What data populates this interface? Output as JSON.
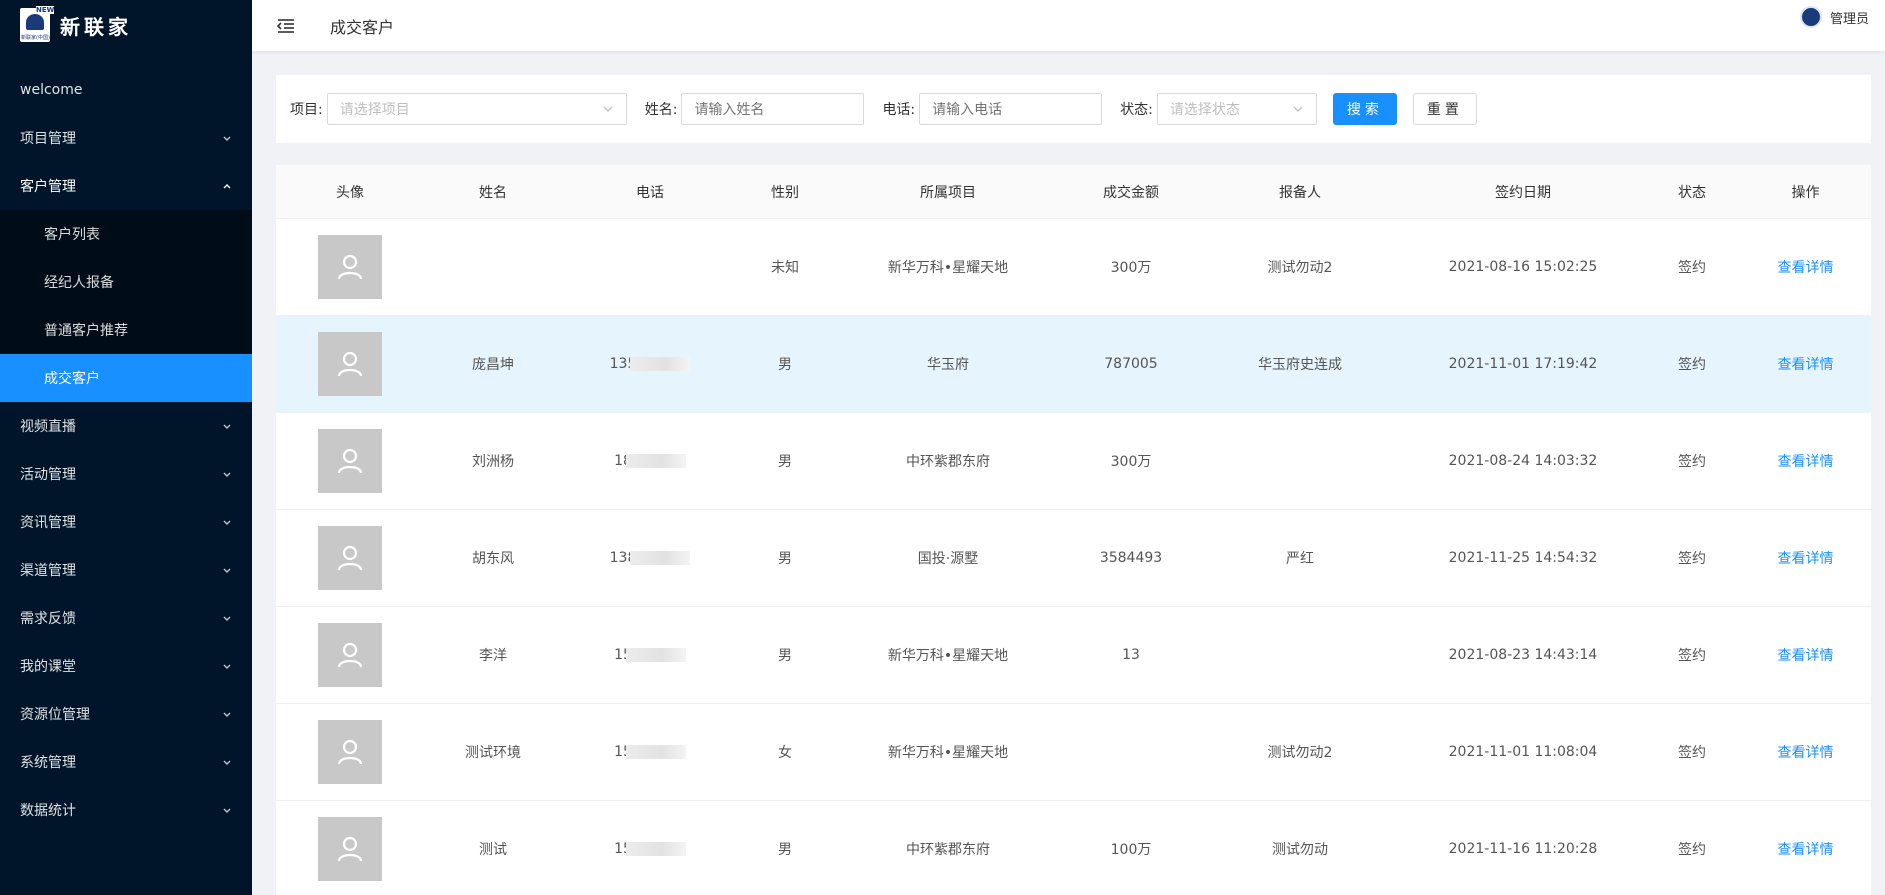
{
  "brand": {
    "name": "新联家",
    "mark_tag": "NEW",
    "mark_sub": "新联家(中国)"
  },
  "sidebar": {
    "items": [
      {
        "label": "welcome",
        "has_children": false
      },
      {
        "label": "项目管理",
        "has_children": true
      },
      {
        "label": "客户管理",
        "has_children": true,
        "open": true,
        "children": [
          {
            "label": "客户列表"
          },
          {
            "label": "经纪人报备"
          },
          {
            "label": "普通客户推荐"
          },
          {
            "label": "成交客户",
            "active": true
          }
        ]
      },
      {
        "label": "视频直播",
        "has_children": true
      },
      {
        "label": "活动管理",
        "has_children": true
      },
      {
        "label": "资讯管理",
        "has_children": true
      },
      {
        "label": "渠道管理",
        "has_children": true
      },
      {
        "label": "需求反馈",
        "has_children": true
      },
      {
        "label": "我的课堂",
        "has_children": true
      },
      {
        "label": "资源位管理",
        "has_children": true
      },
      {
        "label": "系统管理",
        "has_children": true
      },
      {
        "label": "数据统计",
        "has_children": true
      }
    ]
  },
  "header": {
    "title": "成交客户",
    "user": "管理员"
  },
  "filter": {
    "project_label": "项目:",
    "project_placeholder": "请选择项目",
    "name_label": "姓名:",
    "name_placeholder": "请输入姓名",
    "phone_label": "电话:",
    "phone_placeholder": "请输入电话",
    "status_label": "状态:",
    "status_placeholder": "请选择状态",
    "search_btn": "搜索",
    "reset_btn": "重置"
  },
  "table": {
    "columns": [
      "头像",
      "姓名",
      "电话",
      "性别",
      "所属项目",
      "成交金额",
      "报备人",
      "签约日期",
      "状态",
      "操作"
    ],
    "rows": [
      {
        "name": "",
        "phone": "",
        "gender": "未知",
        "project": "新华万科•星耀天地",
        "amount": "300万",
        "reporter": "测试勿动2",
        "date": "2021-08-16 15:02:25",
        "status": "签约",
        "action": "查看详情",
        "highlight": false
      },
      {
        "name": "庞昌坤",
        "phone": "135",
        "gender": "男",
        "project": "华玉府",
        "amount": "787005",
        "reporter": "华玉府史连成",
        "date": "2021-11-01 17:19:42",
        "status": "签约",
        "action": "查看详情",
        "highlight": true
      },
      {
        "name": "刘洲杨",
        "phone": "18",
        "gender": "男",
        "project": "中环紫郡东府",
        "amount": "300万",
        "reporter": "",
        "date": "2021-08-24 14:03:32",
        "status": "签约",
        "action": "查看详情",
        "highlight": false
      },
      {
        "name": "胡东风",
        "phone": "138",
        "gender": "男",
        "project": "国投·源墅",
        "amount": "3584493",
        "reporter": "严红",
        "date": "2021-11-25 14:54:32",
        "status": "签约",
        "action": "查看详情",
        "highlight": false
      },
      {
        "name": "李洋",
        "phone": "15",
        "gender": "男",
        "project": "新华万科•星耀天地",
        "amount": "13",
        "reporter": "",
        "date": "2021-08-23 14:43:14",
        "status": "签约",
        "action": "查看详情",
        "highlight": false
      },
      {
        "name": "测试环境",
        "phone": "15",
        "gender": "女",
        "project": "新华万科•星耀天地",
        "amount": "",
        "reporter": "测试勿动2",
        "date": "2021-11-01 11:08:04",
        "status": "签约",
        "action": "查看详情",
        "highlight": false
      },
      {
        "name": "测试",
        "phone": "15",
        "gender": "男",
        "project": "中环紫郡东府",
        "amount": "100万",
        "reporter": "测试勿动",
        "date": "2021-11-16 11:20:28",
        "status": "签约",
        "action": "查看详情",
        "highlight": false
      }
    ]
  },
  "colors": {
    "sidebar_bg": "#001529",
    "submenu_bg": "#000c17",
    "accent": "#1890ff",
    "row_highlight": "#e6f4fd"
  }
}
